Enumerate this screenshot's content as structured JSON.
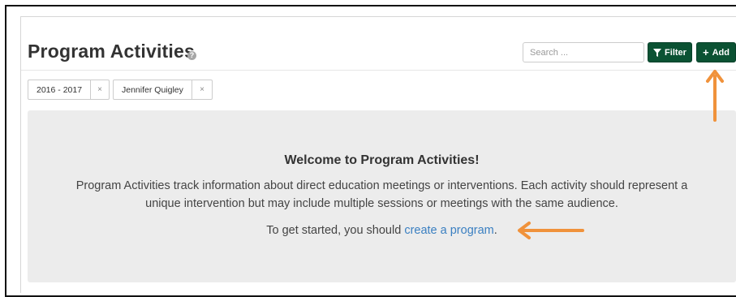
{
  "header": {
    "title": "Program Activities",
    "help_icon": "help-circle-icon",
    "search": {
      "placeholder": "Search ...",
      "value": ""
    },
    "filter_button": {
      "label": "Filter",
      "icon": "funnel-icon"
    },
    "add_button": {
      "label": "Add",
      "icon": "plus-icon"
    }
  },
  "filters": {
    "chips": [
      {
        "label": "2016 - 2017",
        "remove": "×"
      },
      {
        "label": "Jennifer Quigley",
        "remove": "×"
      }
    ]
  },
  "welcome": {
    "title": "Welcome to Program Activities!",
    "body": "Program Activities track information about direct education meetings or interventions. Each activity should represent a unique intervention but may include multiple sessions or meetings with the same audience.",
    "cta_prefix": "To get started, you should ",
    "cta_link": "create a program",
    "cta_suffix": "."
  },
  "annotations": {
    "arrow_color": "#f0923b"
  },
  "colors": {
    "primary_button": "#0b5233",
    "link": "#3a7fc1",
    "panel_bg": "#ececec"
  }
}
